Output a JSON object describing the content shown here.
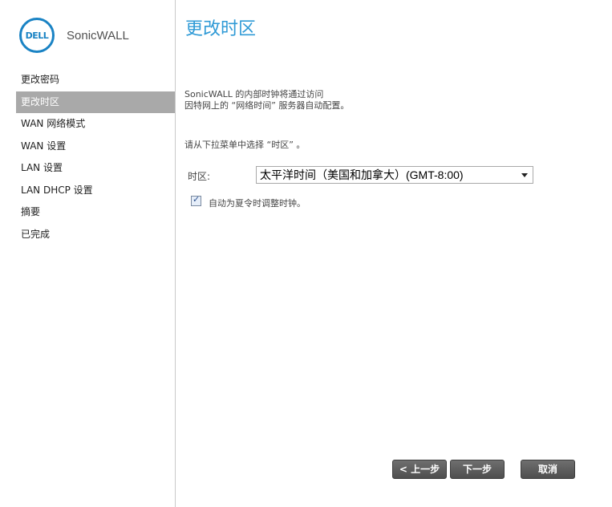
{
  "brand": {
    "logo_text": "DELL",
    "name": "SonicWALL",
    "accent_color": "#1a83c4"
  },
  "sidebar": {
    "items": [
      {
        "label": "更改密码",
        "active": false
      },
      {
        "label": "更改时区",
        "active": true
      },
      {
        "label": "WAN 网络模式",
        "active": false
      },
      {
        "label": "WAN 设置",
        "active": false
      },
      {
        "label": "LAN 设置",
        "active": false
      },
      {
        "label": "LAN DHCP 设置",
        "active": false
      },
      {
        "label": "摘要",
        "active": false
      },
      {
        "label": "已完成",
        "active": false
      }
    ]
  },
  "main": {
    "title": "更改时区",
    "description_line1": "SonicWALL 的内部时钟将通过访问",
    "description_line2": "因特网上的 “网络时间” 服务器自动配置。",
    "instruction": "请从下拉菜单中选择 “时区” 。",
    "timezone_label": "时区:",
    "timezone_value": "太平洋时间（美国和加拿大）(GMT-8:00)",
    "dst_checkbox_checked": true,
    "dst_checkbox_label": "自动为夏令时调整时钟。"
  },
  "buttons": {
    "prev": "< 上一步",
    "next": "下一步",
    "cancel": "取消"
  },
  "colors": {
    "title": "#2f9ad6",
    "active_nav_bg": "#a9a9a9",
    "button_bg": "#5e5e5e"
  }
}
